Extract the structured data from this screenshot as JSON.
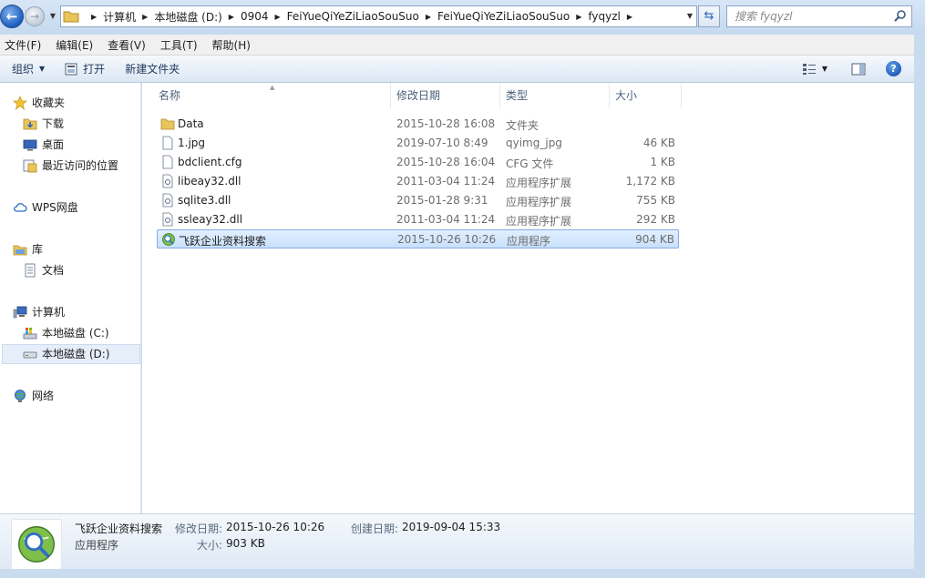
{
  "address": {
    "crumbs": [
      "计算机",
      "本地磁盘 (D:)",
      "0904",
      "FeiYueQiYeZiLiaoSouSuo",
      "FeiYueQiYeZiLiaoSouSuo",
      "fyqyzl"
    ]
  },
  "search": {
    "placeholder": "搜索 fyqyzl"
  },
  "menu": [
    "文件(F)",
    "编辑(E)",
    "查看(V)",
    "工具(T)",
    "帮助(H)"
  ],
  "toolbar": {
    "organize": "组织",
    "open": "打开",
    "new_folder": "新建文件夹"
  },
  "nav": {
    "favorites": "收藏夹",
    "downloads": "下载",
    "desktop": "桌面",
    "recent": "最近访问的位置",
    "wps": "WPS网盘",
    "library": "库",
    "documents": "文档",
    "computer": "计算机",
    "drive_c": "本地磁盘 (C:)",
    "drive_d": "本地磁盘 (D:)",
    "network": "网络"
  },
  "columns": {
    "name": "名称",
    "date": "修改日期",
    "type": "类型",
    "size": "大小"
  },
  "files": [
    {
      "name": "Data",
      "date": "2015-10-28 16:08",
      "type": "文件夹",
      "size": "",
      "icon": "folder-icon"
    },
    {
      "name": "1.jpg",
      "date": "2019-07-10 8:49",
      "type": "qyimg_jpg",
      "size": "46 KB",
      "icon": "file-icon"
    },
    {
      "name": "bdclient.cfg",
      "date": "2015-10-28 16:04",
      "type": "CFG 文件",
      "size": "1 KB",
      "icon": "file-icon"
    },
    {
      "name": "libeay32.dll",
      "date": "2011-03-04 11:24",
      "type": "应用程序扩展",
      "size": "1,172 KB",
      "icon": "dll-icon"
    },
    {
      "name": "sqlite3.dll",
      "date": "2015-01-28 9:31",
      "type": "应用程序扩展",
      "size": "755 KB",
      "icon": "dll-icon"
    },
    {
      "name": "ssleay32.dll",
      "date": "2011-03-04 11:24",
      "type": "应用程序扩展",
      "size": "292 KB",
      "icon": "dll-icon"
    },
    {
      "name": "飞跃企业资料搜索",
      "date": "2015-10-26 10:26",
      "type": "应用程序",
      "size": "904 KB",
      "icon": "app-icon"
    }
  ],
  "details": {
    "name": "飞跃企业资料搜索",
    "type": "应用程序",
    "modified_label": "修改日期:",
    "modified": "2015-10-26 10:26",
    "created_label": "创建日期:",
    "created": "2019-09-04 15:33",
    "size_label": "大小:",
    "size": "903 KB"
  }
}
